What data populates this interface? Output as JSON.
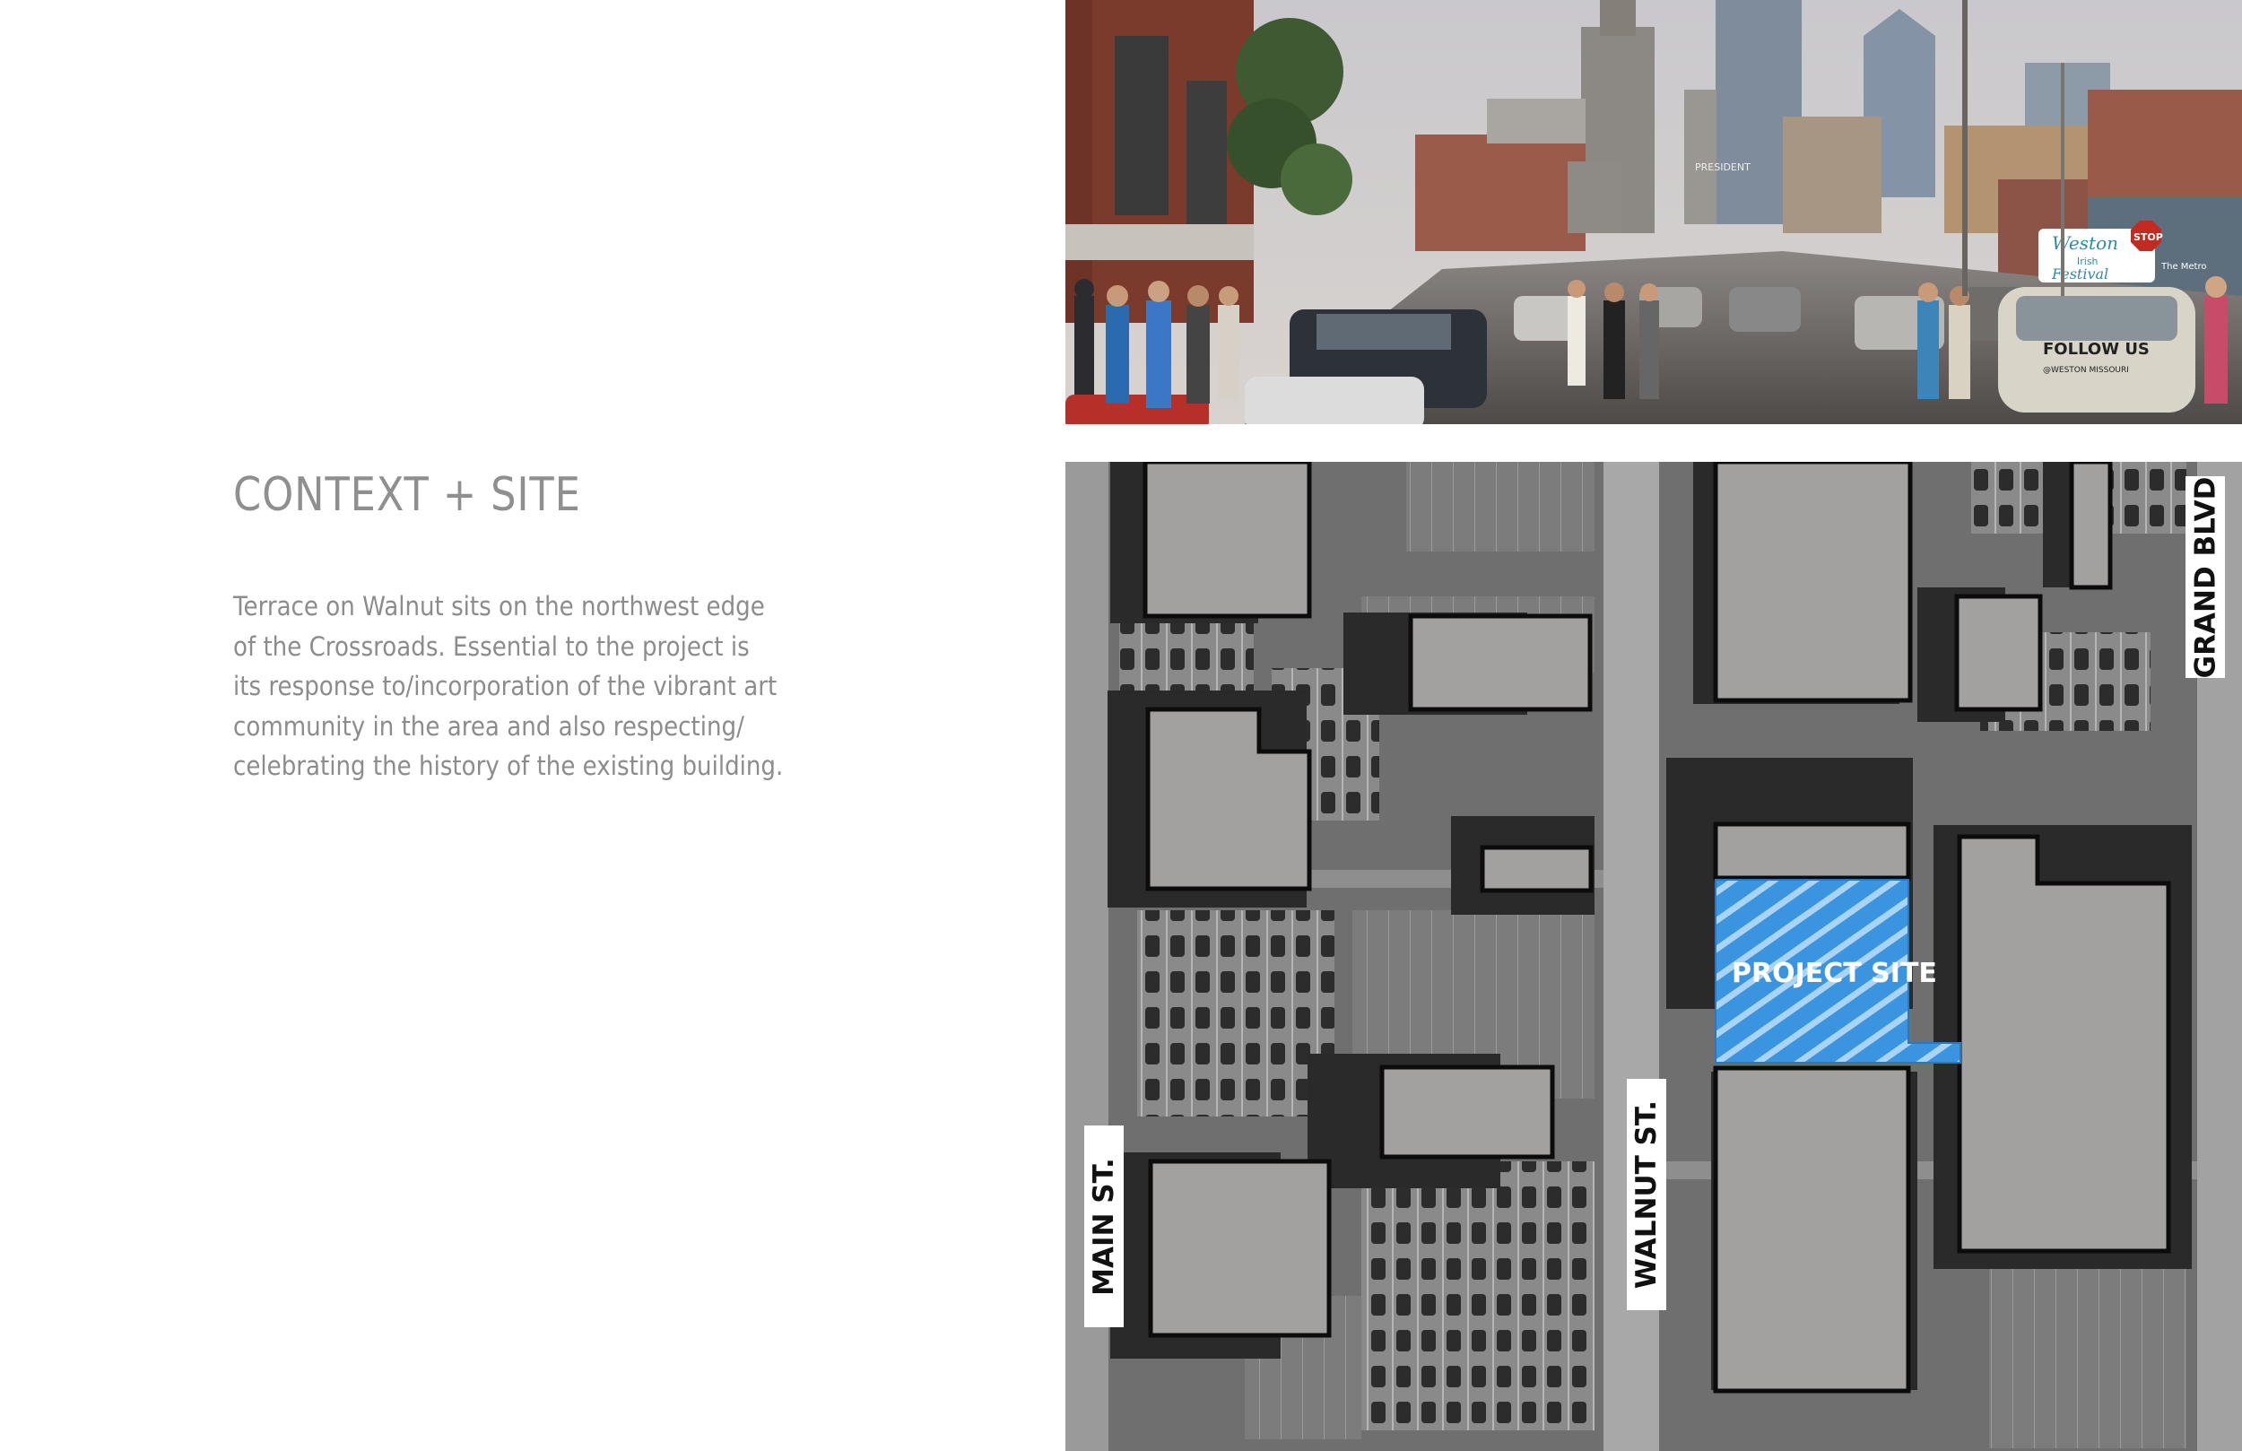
{
  "intro": {
    "heading": "CONTEXT + SITE",
    "paragraph_lines": [
      "Terrace on Walnut sits on the northwest edge",
      "of the Crossroads. Essential to the project is",
      "its response to/incorporation of the vibrant art",
      "community in the area and also respecting/",
      "celebrating the history of the existing building."
    ]
  },
  "street_photo": {
    "signs": {
      "stop": "STOP",
      "banner_line1": "Weston",
      "banner_line2": "Irish",
      "banner_line3": "Festival",
      "van_text_1": "FOLLOW US",
      "van_text_2": "@WESTON MISSOURI",
      "metro_sign": "The Metro",
      "president": "PRESIDENT"
    }
  },
  "site_plan": {
    "streets": {
      "main": "MAIN ST.",
      "walnut": "WALNUT ST.",
      "grand": "GRAND BLVD"
    },
    "project_site_label": "PROJECT SITE",
    "colors": {
      "building_fill": "#a3a1a0",
      "project_site": "#3a94e0",
      "aerial_base": "#6f6f6f"
    }
  }
}
